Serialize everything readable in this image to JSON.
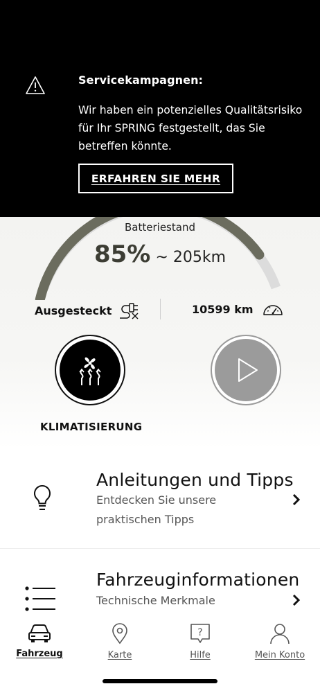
{
  "banner": {
    "title": "Servicekampagnen:",
    "message": "Wir haben ein potenzielles Qualitätsrisiko für Ihr SPRING festgestellt, das Sie betreffen könnte.",
    "button_label": "ERFAHREN SIE MEHR",
    "icon": "warning-icon"
  },
  "battery": {
    "label": "Batteriestand",
    "percent": "85%",
    "range": "~ 205km",
    "level": 0.85,
    "gauge_color": "#6b6c5e"
  },
  "status_row": {
    "charging_status": "Ausgesteckt",
    "charging_icon": "unplugged-icon",
    "odometer": "10599 km",
    "odometer_icon": "speedometer-icon"
  },
  "actions": {
    "climate_label": "KLIMATISIERUNG",
    "climate_icon": "fan-heat-icon",
    "play_icon": "play-icon"
  },
  "cards": [
    {
      "title": "Anleitungen und Tipps",
      "subtitle": "Entdecken Sie unsere praktischen Tipps",
      "icon": "lightbulb-icon"
    },
    {
      "title": "Fahrzeuginformationen",
      "subtitle": "Technische Merkmale",
      "icon": "list-icon"
    }
  ],
  "nav": {
    "items": [
      {
        "label": "Fahrzeug",
        "icon": "car-icon",
        "active": true
      },
      {
        "label": "Karte",
        "icon": "map-pin-icon",
        "active": false
      },
      {
        "label": "Hilfe",
        "icon": "help-icon",
        "active": false
      },
      {
        "label": "Mein Konto",
        "icon": "account-icon",
        "active": false
      }
    ]
  },
  "colors": {
    "banner_bg": "#000000",
    "accent_dark": "#3c3d34",
    "disabled_gray": "#9b9b9b"
  }
}
